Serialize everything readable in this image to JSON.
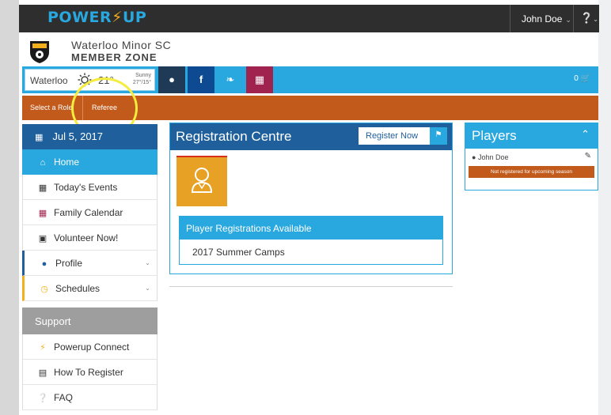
{
  "brand": {
    "logo_left": "POWER",
    "logo_bolt": "⚡",
    "logo_right": "UP"
  },
  "header": {
    "user_name": "John Doe",
    "help_icon": "question-icon"
  },
  "club": {
    "name": "Waterloo Minor SC",
    "subtitle": "MEMBER ZONE"
  },
  "weather": {
    "city": "Waterloo",
    "temp": "21°",
    "condition": "Sunny",
    "range": "27°/15°"
  },
  "social": {
    "web": "●",
    "facebook": "f",
    "twitter": "❧",
    "calendar": "▦"
  },
  "cart": {
    "count": "0"
  },
  "role": {
    "label": "Select a Role",
    "value": "Referee"
  },
  "sidebar": {
    "date": "Jul 5, 2017",
    "items": [
      {
        "label": "Home",
        "icon": "home-icon"
      },
      {
        "label": "Today's Events",
        "icon": "calendar-icon"
      },
      {
        "label": "Family Calendar",
        "icon": "calendar-icon"
      },
      {
        "label": "Volunteer Now!",
        "icon": "briefcase-icon"
      },
      {
        "label": "Profile",
        "icon": "user-icon"
      },
      {
        "label": "Schedules",
        "icon": "clock-icon"
      }
    ],
    "support": {
      "title": "Support",
      "items": [
        {
          "label": "Powerup Connect",
          "icon": "bolt-icon"
        },
        {
          "label": "How To Register",
          "icon": "document-icon"
        },
        {
          "label": "FAQ",
          "icon": "question-icon"
        }
      ]
    }
  },
  "registration": {
    "title": "Registration Centre",
    "button": "Register Now",
    "available_title": "Player Registrations Available",
    "available_items": [
      "2017 Summer Camps"
    ]
  },
  "players": {
    "title": "Players",
    "list": [
      {
        "name": "John Doe",
        "status": "Not registered for upcoming season"
      }
    ]
  },
  "colors": {
    "topbar": "#2e2e2e",
    "brand_blue": "#29a8e0",
    "dark_blue": "#1e5f9c",
    "role_orange": "#c15a1b",
    "tile_orange": "#e7a124",
    "highlight_yellow": "#f4ec3e"
  }
}
